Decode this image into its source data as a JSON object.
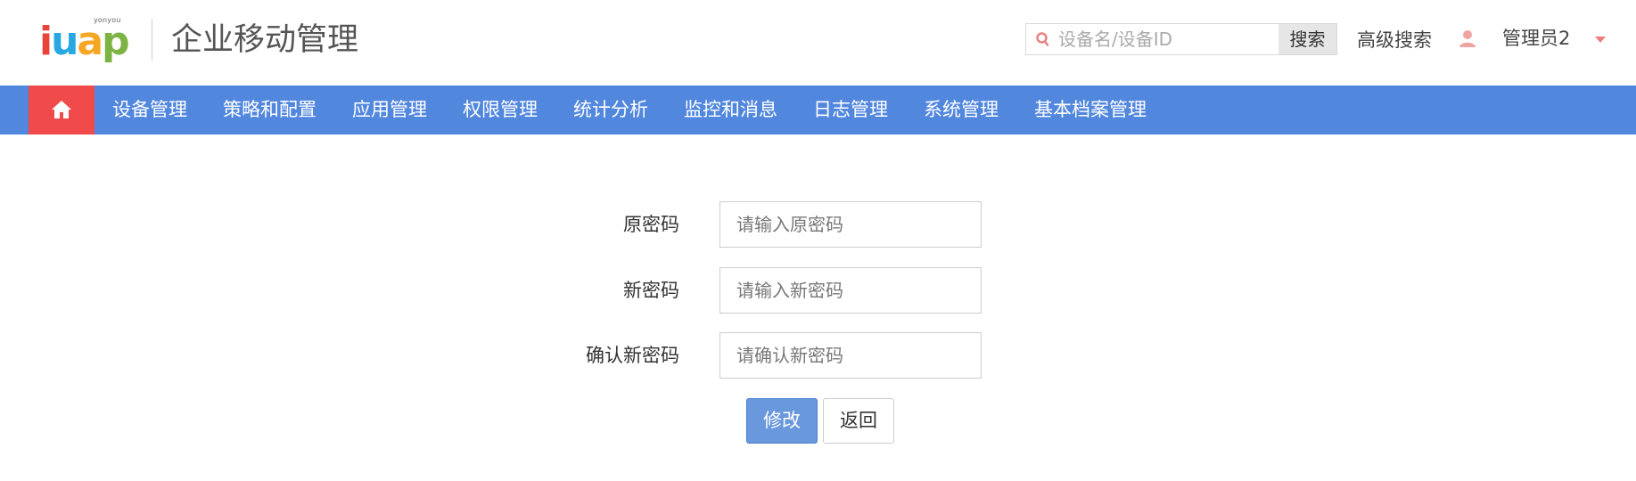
{
  "header": {
    "logo_small": "yonyou",
    "logo_letters": [
      "i",
      "u",
      "a",
      "p"
    ],
    "app_title": "企业移动管理",
    "search_placeholder": "设备名/设备ID",
    "search_button": "搜索",
    "advanced_search": "高级搜索",
    "user_name": "管理员2"
  },
  "nav": {
    "items": [
      {
        "label": "设备管理"
      },
      {
        "label": "策略和配置"
      },
      {
        "label": "应用管理"
      },
      {
        "label": "权限管理"
      },
      {
        "label": "统计分析"
      },
      {
        "label": "监控和消息"
      },
      {
        "label": "日志管理"
      },
      {
        "label": "系统管理"
      },
      {
        "label": "基本档案管理"
      }
    ]
  },
  "form": {
    "old_password": {
      "label": "原密码",
      "placeholder": "请输入原密码",
      "value": ""
    },
    "new_password": {
      "label": "新密码",
      "placeholder": "请输入新密码",
      "value": ""
    },
    "confirm_password": {
      "label": "确认新密码",
      "placeholder": "请确认新密码",
      "value": ""
    },
    "submit_label": "修改",
    "back_label": "返回"
  },
  "colors": {
    "nav_bg": "#5287de",
    "home_bg": "#f04a4a",
    "primary_button": "#6a98dc",
    "accent_red": "#e9807f"
  }
}
